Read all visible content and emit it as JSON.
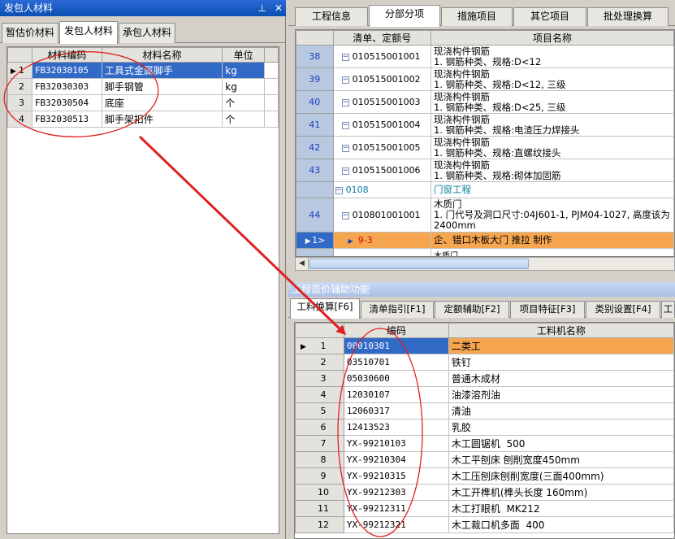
{
  "left_panel": {
    "title": "发包人材料",
    "pin_icon": "pin-icon",
    "close_icon": "close-icon",
    "tabs": [
      {
        "label": "暂估价材料"
      },
      {
        "label": "发包人材料"
      },
      {
        "label": "承包人材料"
      }
    ],
    "active_tab": 1,
    "columns": [
      "材料编码",
      "材料名称",
      "单位"
    ],
    "rows": [
      {
        "n": "1",
        "code": "FB32030105",
        "name": "工具式金属脚手",
        "unit": "kg"
      },
      {
        "n": "2",
        "code": "FB32030303",
        "name": "脚手钢管",
        "unit": "kg"
      },
      {
        "n": "3",
        "code": "FB32030504",
        "name": "底座",
        "unit": "个"
      },
      {
        "n": "4",
        "code": "FB32030513",
        "name": "脚手架扣件",
        "unit": "个"
      }
    ]
  },
  "right_top": {
    "tabs": [
      {
        "label": "工程信息"
      },
      {
        "label": "分部分项"
      },
      {
        "label": "措施项目"
      },
      {
        "label": "其它项目"
      },
      {
        "label": "批处理换算"
      }
    ],
    "active_tab": 1,
    "columns": [
      "清单、定额号",
      "项目名称"
    ],
    "rows": [
      {
        "n": "38",
        "code": "010515001001",
        "name": "现浇构件钢筋\n1. 钢筋种类、规格:D<12"
      },
      {
        "n": "39",
        "code": "010515001002",
        "name": "现浇构件钢筋\n1. 钢筋种类、规格:D<12, 三级"
      },
      {
        "n": "40",
        "code": "010515001003",
        "name": "现浇构件钢筋\n1. 钢筋种类、规格:D<25, 三级"
      },
      {
        "n": "41",
        "code": "010515001004",
        "name": "现浇构件钢筋\n1. 钢筋种类、规格:电渣压力焊接头"
      },
      {
        "n": "42",
        "code": "010515001005",
        "name": "现浇构件钢筋\n1. 钢筋种类、规格:直螺纹接头"
      },
      {
        "n": "43",
        "code": "010515001006",
        "name": "现浇构件钢筋\n1. 钢筋种类、规格:砌体加固筋"
      },
      {
        "n": "",
        "code": "0108",
        "name": "门窗工程"
      },
      {
        "n": "44",
        "code": "010801001001",
        "name": "木质门\n1. 门代号及洞口尺寸:04J601-1, PJM04-1027, 高度该为\n2400mm"
      },
      {
        "n": "1>",
        "code": "9-3",
        "name": "企、错口木板大门 推拉 制作"
      }
    ],
    "partial_row_name": "木质门"
  },
  "right_bottom": {
    "title": "工程造价辅助功能",
    "tabs": [
      {
        "label": "工料换算[F6]"
      },
      {
        "label": "清单指引[F1]"
      },
      {
        "label": "定额辅助[F2]"
      },
      {
        "label": "项目特征[F3]"
      },
      {
        "label": "类别设置[F4]"
      },
      {
        "label": "工"
      }
    ],
    "active_tab": 0,
    "columns": [
      "编码",
      "工料机名称"
    ],
    "rows": [
      {
        "n": "1",
        "code": "00010301",
        "name": "二类工"
      },
      {
        "n": "2",
        "code": "03510701",
        "name": "铁钉"
      },
      {
        "n": "3",
        "code": "05030600",
        "name": "普通木成材"
      },
      {
        "n": "4",
        "code": "12030107",
        "name": "油漆溶剂油"
      },
      {
        "n": "5",
        "code": "12060317",
        "name": "清油"
      },
      {
        "n": "6",
        "code": "12413523",
        "name": "乳胶"
      },
      {
        "n": "7",
        "code": "YX-99210103",
        "name": "木工圆锯机  500"
      },
      {
        "n": "8",
        "code": "YX-99210304",
        "name": "木工平刨床 刨削宽度450mm"
      },
      {
        "n": "9",
        "code": "YX-99210315",
        "name": "木工压刨床刨削宽度(三面400mm)"
      },
      {
        "n": "10",
        "code": "YX-99212303",
        "name": "木工开榫机(榫头长度 160mm)"
      },
      {
        "n": "11",
        "code": "YX-99212311",
        "name": "木工打眼机  MK212"
      },
      {
        "n": "12",
        "code": "YX-99212321",
        "name": "木工裁口机多面  400"
      }
    ]
  },
  "colors": {
    "selection_blue": "#3169c6",
    "highlight_orange": "#f7a650",
    "annotation_red": "#e02020",
    "row_number_blue": "#1a3cba"
  }
}
